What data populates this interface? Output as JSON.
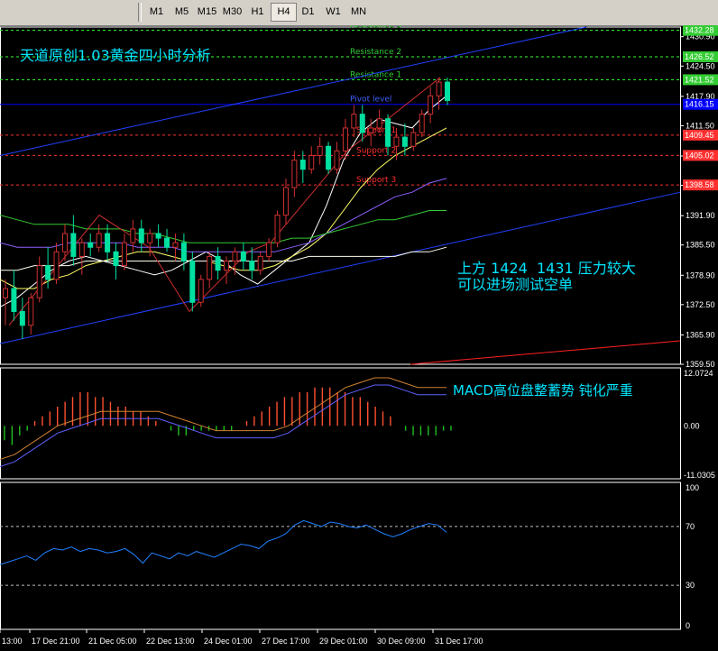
{
  "toolbar": {
    "timeframes": [
      "M1",
      "M5",
      "M15",
      "M30",
      "H1",
      "H4",
      "D1",
      "W1",
      "MN"
    ],
    "active": "H4"
  },
  "annotations": {
    "title": "天道原创1.03黄金四小时分析",
    "comment_line1": "上方 1424  1431 压力较大",
    "comment_line2": "可以进场测试空单",
    "macd_comment": "MACD高位盘整蓄势 钝化严重"
  },
  "colors": {
    "background": "#000000",
    "bull_candle": "#000000",
    "bear_candle": "#00e0a0",
    "candle_outline_up": "#d03030",
    "ma_fast": "#ffffff",
    "ma_mid": "#ffff66",
    "ma_slow": "#9060ff",
    "ma_green": "#33cc33",
    "ma_long": "#ffffee",
    "channel": "#2040ff",
    "resistance": "#33ff33",
    "support": "#ff3030",
    "pivot": "#0000ff",
    "annotation": "#00e5ff"
  },
  "chart_data": [
    {
      "type": "candlestick",
      "title": "",
      "x_tick_labels": [
        "13:00",
        "17 Dec 21:00",
        "21 Dec 05:00",
        "22 Dec 13:00",
        "24 Dec 01:00",
        "27 Dec 17:00",
        "29 Dec 01:00",
        "30 Dec 09:00",
        "31 Dec 17:00"
      ],
      "y_tick_labels": [
        1430.9,
        1424.5,
        1417.9,
        1411.5,
        1404.9,
        1398.5,
        1391.9,
        1385.5,
        1378.9,
        1372.5,
        1365.9,
        1359.5
      ],
      "ylim": [
        1359.5,
        1433
      ],
      "price_tags": [
        {
          "label": "1432.28",
          "value": 1432.28,
          "color": "#33cc33"
        },
        {
          "label": "1426.52",
          "value": 1426.52,
          "color": "#33cc33"
        },
        {
          "label": "1421.52",
          "value": 1421.52,
          "color": "#33cc33"
        },
        {
          "label": "1416.15",
          "value": 1416.15,
          "color": "#0000ff"
        },
        {
          "label": "1409.45",
          "value": 1409.45,
          "color": "#ff3030"
        },
        {
          "label": "1405.02",
          "value": 1405.02,
          "color": "#ff3030"
        },
        {
          "label": "1398.58",
          "value": 1398.58,
          "color": "#ff3030"
        }
      ],
      "levels": [
        {
          "name": "Resistance 3",
          "value": 1432.28,
          "kind": "resistance"
        },
        {
          "name": "Resistance 2",
          "value": 1426.52,
          "kind": "resistance"
        },
        {
          "name": "Resistance 1",
          "value": 1421.52,
          "kind": "resistance"
        },
        {
          "name": "Pivot level",
          "value": 1416.15,
          "kind": "pivot"
        },
        {
          "name": "Support 1",
          "value": 1409.45,
          "kind": "support"
        },
        {
          "name": "Support 2",
          "value": 1405.02,
          "kind": "support"
        },
        {
          "name": "Support 3",
          "value": 1398.58,
          "kind": "support"
        }
      ],
      "candles": [
        [
          1374,
          1378,
          1368,
          1376
        ],
        [
          1376,
          1380,
          1369,
          1371
        ],
        [
          1371,
          1374,
          1365,
          1368
        ],
        [
          1368,
          1375,
          1366,
          1374
        ],
        [
          1374,
          1383,
          1373,
          1381
        ],
        [
          1381,
          1385,
          1376,
          1378
        ],
        [
          1378,
          1386,
          1377,
          1384
        ],
        [
          1384,
          1390,
          1382,
          1388
        ],
        [
          1388,
          1392,
          1381,
          1383
        ],
        [
          1383,
          1387,
          1379,
          1386
        ],
        [
          1386,
          1388,
          1383,
          1385
        ],
        [
          1385,
          1390,
          1384,
          1388
        ],
        [
          1388,
          1390,
          1382,
          1384
        ],
        [
          1384,
          1386,
          1378,
          1381
        ],
        [
          1381,
          1388,
          1380,
          1386
        ],
        [
          1386,
          1391,
          1384,
          1389
        ],
        [
          1389,
          1391,
          1384,
          1386
        ],
        [
          1386,
          1389,
          1383,
          1388
        ],
        [
          1388,
          1390,
          1385,
          1387
        ],
        [
          1387,
          1389,
          1384,
          1385
        ],
        [
          1385,
          1388,
          1382,
          1386
        ],
        [
          1386,
          1388,
          1380,
          1382
        ],
        [
          1382,
          1384,
          1371,
          1373
        ],
        [
          1373,
          1379,
          1372,
          1378
        ],
        [
          1378,
          1384,
          1376,
          1383
        ],
        [
          1383,
          1385,
          1378,
          1380
        ],
        [
          1380,
          1383,
          1377,
          1382
        ],
        [
          1382,
          1385,
          1379,
          1384
        ],
        [
          1384,
          1386,
          1380,
          1382
        ],
        [
          1382,
          1385,
          1378,
          1380
        ],
        [
          1380,
          1384,
          1379,
          1383
        ],
        [
          1383,
          1387,
          1382,
          1386
        ],
        [
          1386,
          1393,
          1385,
          1392
        ],
        [
          1392,
          1400,
          1390,
          1398
        ],
        [
          1398,
          1406,
          1396,
          1404
        ],
        [
          1404,
          1406,
          1399,
          1402
        ],
        [
          1402,
          1407,
          1401,
          1405
        ],
        [
          1405,
          1409,
          1403,
          1407
        ],
        [
          1407,
          1408,
          1401,
          1402
        ],
        [
          1402,
          1408,
          1401,
          1406
        ],
        [
          1406,
          1413,
          1404,
          1411
        ],
        [
          1411,
          1416,
          1409,
          1414
        ],
        [
          1414,
          1416,
          1408,
          1410
        ],
        [
          1410,
          1413,
          1407,
          1411
        ],
        [
          1411,
          1415,
          1410,
          1413
        ],
        [
          1413,
          1414,
          1405,
          1407
        ],
        [
          1407,
          1411,
          1404,
          1409
        ],
        [
          1409,
          1412,
          1405,
          1407
        ],
        [
          1407,
          1411,
          1406,
          1410
        ],
        [
          1410,
          1415,
          1409,
          1414
        ],
        [
          1414,
          1420,
          1412,
          1418
        ],
        [
          1418,
          1422,
          1415,
          1421
        ],
        [
          1421,
          1422,
          1416,
          1417
        ]
      ],
      "moving_averages": [
        {
          "name": "",
          "color": "#ffffff",
          "values": [
            1372,
            1374,
            1377,
            1380,
            1382,
            1383,
            1382,
            1381,
            1380,
            1379,
            1380,
            1382,
            1384,
            1382,
            1379,
            1377,
            1380,
            1383,
            1386,
            1394,
            1404,
            1410,
            1413,
            1412,
            1411,
            1415,
            1418
          ]
        },
        {
          "name": "",
          "color": "#ffff66",
          "values": [
            1378,
            1376,
            1376,
            1378,
            1379,
            1381,
            1382,
            1383,
            1384,
            1384,
            1383,
            1382,
            1382,
            1381,
            1380,
            1380,
            1381,
            1383,
            1385,
            1388,
            1393,
            1398,
            1402,
            1405,
            1407,
            1409,
            1411
          ]
        },
        {
          "name": "",
          "color": "#9060ff",
          "values": [
            1386,
            1385,
            1385,
            1385,
            1386,
            1386,
            1386,
            1386,
            1385,
            1385,
            1385,
            1384,
            1384,
            1384,
            1384,
            1384,
            1384,
            1385,
            1386,
            1388,
            1390,
            1392,
            1394,
            1396,
            1397,
            1399,
            1400
          ]
        },
        {
          "name": "",
          "color": "#33cc33",
          "values": [
            1392,
            1391,
            1390,
            1390,
            1390,
            1389,
            1389,
            1389,
            1388,
            1388,
            1387,
            1386,
            1386,
            1386,
            1386,
            1386,
            1386,
            1387,
            1387,
            1388,
            1389,
            1390,
            1391,
            1391,
            1392,
            1393,
            1393
          ]
        },
        {
          "name": "",
          "color": "#ffffee",
          "values": [
            1380,
            1380,
            1381,
            1381,
            1381,
            1382,
            1382,
            1382,
            1382,
            1382,
            1382,
            1382,
            1382,
            1382,
            1382,
            1382,
            1382,
            1382,
            1383,
            1383,
            1383,
            1383,
            1383,
            1383,
            1384,
            1384,
            1385
          ]
        }
      ]
    },
    {
      "type": "bar",
      "title": "",
      "y_tick_labels": [
        12.0724,
        0.0,
        -11.0305
      ],
      "ylim": [
        -11.0305,
        12.0724
      ],
      "histogram": [
        -3,
        -4,
        -2,
        -1,
        1,
        2,
        3,
        4,
        5,
        6,
        7,
        7,
        6,
        6,
        5,
        4,
        4,
        3,
        3,
        2,
        1,
        0,
        -1,
        -2,
        -2,
        -1,
        -1,
        -1,
        -1,
        -1,
        -1,
        0,
        1,
        2,
        3,
        4,
        5,
        6,
        6,
        7,
        7,
        8,
        8,
        8,
        7,
        7,
        6,
        6,
        5,
        4,
        3,
        2,
        0,
        -1,
        -2,
        -2,
        -2,
        -2,
        -1,
        -1
      ],
      "signal": [
        -7,
        -6,
        -4,
        -2,
        0,
        1,
        2,
        3,
        3,
        3,
        3,
        3,
        2,
        1,
        0,
        -1,
        -1,
        -1,
        -1,
        -1,
        0,
        2,
        4,
        6,
        8,
        9,
        10,
        10,
        9,
        8,
        8,
        8
      ]
    },
    {
      "type": "line",
      "title": "",
      "y_tick_labels": [
        100,
        70,
        30,
        0
      ],
      "ylim": [
        0,
        100
      ],
      "levels": [
        70,
        30
      ],
      "values": [
        44,
        46,
        48,
        50,
        47,
        52,
        55,
        54,
        56,
        53,
        55,
        54,
        52,
        53,
        55,
        51,
        45,
        52,
        50,
        48,
        52,
        50,
        53,
        51,
        49,
        52,
        55,
        58,
        57,
        55,
        60,
        62,
        65,
        71,
        74,
        72,
        70,
        73,
        72,
        70,
        69,
        71,
        68,
        65,
        63,
        65,
        68,
        70,
        72,
        71,
        66
      ]
    }
  ]
}
